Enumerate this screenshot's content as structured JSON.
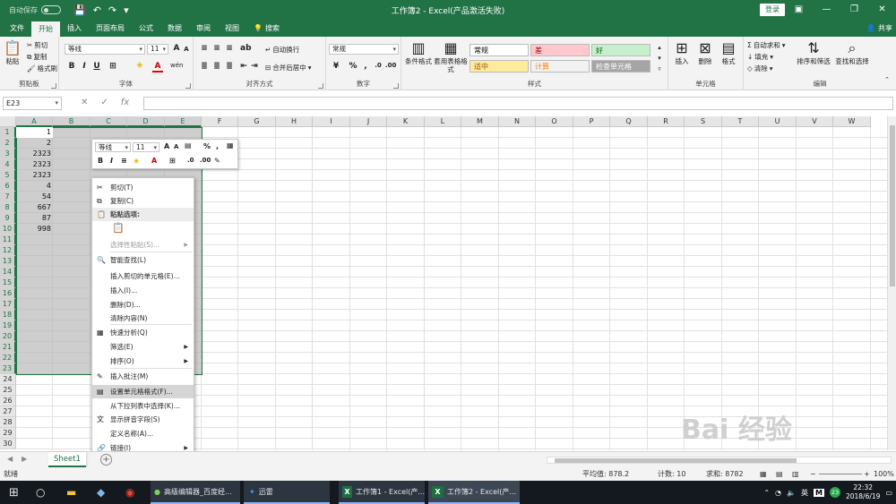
{
  "titlebar": {
    "autosave": "自动保存",
    "autosave_state": "●",
    "doc_title": "工作簿2 - Excel(产品激活失败)",
    "login": "登录"
  },
  "tabs": [
    "文件",
    "开始",
    "插入",
    "页面布局",
    "公式",
    "数据",
    "审阅",
    "视图"
  ],
  "tell_me": "搜索",
  "share": "共享",
  "ribbon": {
    "clipboard": {
      "paste": "粘贴",
      "cut": "剪切",
      "copy": "复制",
      "format_painter": "格式刷",
      "label": "剪贴板"
    },
    "font": {
      "name": "等线",
      "size": "11",
      "bold": "B",
      "italic": "I",
      "underline": "U",
      "grow": "A",
      "shrink": "A",
      "font_color": "A",
      "wen": "wén",
      "label": "字体"
    },
    "alignment": {
      "wrap": "自动换行",
      "merge": "合并后居中",
      "label": "对齐方式"
    },
    "number": {
      "format": "常规",
      "percent": "%",
      "comma": ",",
      "label": "数字"
    },
    "styles": {
      "conditional": "条件格式",
      "table": "套用表格格式",
      "cells": [
        {
          "text": "常规",
          "bg": "#ffffff",
          "color": "#000000"
        },
        {
          "text": "差",
          "bg": "#ffc7ce",
          "color": "#9c0006"
        },
        {
          "text": "好",
          "bg": "#c6efce",
          "color": "#006100"
        },
        {
          "text": "适中",
          "bg": "#ffeb9c",
          "color": "#9c5700"
        },
        {
          "text": "计算",
          "bg": "#f2f2f2",
          "color": "#fa7d00"
        },
        {
          "text": "检查单元格",
          "bg": "#a5a5a5",
          "color": "#ffffff"
        }
      ],
      "label": "样式"
    },
    "cells": {
      "insert": "插入",
      "delete": "删除",
      "format": "格式",
      "label": "单元格"
    },
    "editing": {
      "autosum": "自动求和",
      "fill": "填充",
      "clear": "清除",
      "sort": "排序和筛选",
      "find": "查找和选择",
      "label": "编辑"
    }
  },
  "formula_bar": {
    "name_box": "E23",
    "cancel": "✕",
    "enter": "✓",
    "fx": "fx",
    "value": ""
  },
  "columns": [
    "A",
    "B",
    "C",
    "D",
    "E",
    "F",
    "G",
    "H",
    "I",
    "J",
    "K",
    "L",
    "M",
    "N",
    "O",
    "P",
    "Q",
    "R",
    "S",
    "T",
    "U",
    "V",
    "W"
  ],
  "rows": [
    "1",
    "2",
    "3",
    "4",
    "5",
    "6",
    "7",
    "8",
    "9",
    "10",
    "11",
    "12",
    "13",
    "14",
    "15",
    "16",
    "17",
    "18",
    "19",
    "20",
    "21",
    "22",
    "23",
    "24",
    "25",
    "26",
    "27",
    "28",
    "29",
    "30"
  ],
  "cells_a": [
    "1",
    "2",
    "2323",
    "2323",
    "2323",
    "4",
    "54",
    "667",
    "87",
    "998"
  ],
  "mini_toolbar": {
    "font": "等线",
    "size": "11",
    "percent": "%",
    "comma": ","
  },
  "context_menu": [
    {
      "label": "剪切(T)",
      "icon": "✂",
      "kind": "normal"
    },
    {
      "label": "复制(C)",
      "icon": "⧉",
      "kind": "normal"
    },
    {
      "label": "粘贴选项:",
      "icon": "📋",
      "kind": "header"
    },
    {
      "label": "",
      "icon": "📋",
      "kind": "paste-icon"
    },
    {
      "label": "选择性粘贴(S)...",
      "icon": "",
      "kind": "disabled",
      "sub": true
    },
    {
      "label": "智能查找(L)",
      "icon": "🔍",
      "kind": "normal"
    },
    {
      "label": "插入剪切的单元格(E)...",
      "icon": "",
      "kind": "normal"
    },
    {
      "label": "插入(I)...",
      "icon": "",
      "kind": "normal"
    },
    {
      "label": "删除(D)...",
      "icon": "",
      "kind": "normal"
    },
    {
      "label": "清除内容(N)",
      "icon": "",
      "kind": "normal"
    },
    {
      "label": "快速分析(Q)",
      "icon": "▦",
      "kind": "normal"
    },
    {
      "label": "筛选(E)",
      "icon": "",
      "kind": "normal",
      "sub": true
    },
    {
      "label": "排序(O)",
      "icon": "",
      "kind": "normal",
      "sub": true
    },
    {
      "label": "插入批注(M)",
      "icon": "✎",
      "kind": "normal"
    },
    {
      "label": "设置单元格格式(F)...",
      "icon": "▤",
      "kind": "hover"
    },
    {
      "label": "从下拉列表中选择(K)...",
      "icon": "",
      "kind": "normal"
    },
    {
      "label": "显示拼音字段(S)",
      "icon": "文",
      "kind": "normal"
    },
    {
      "label": "定义名称(A)...",
      "icon": "",
      "kind": "normal"
    },
    {
      "label": "链接(I)",
      "icon": "🔗",
      "kind": "normal",
      "sub": true
    }
  ],
  "sheet": {
    "tab": "Sheet1",
    "add": "+"
  },
  "status": {
    "ready": "就绪",
    "average": "平均值: 878.2",
    "count": "计数: 10",
    "sum": "求和: 8782",
    "zoom": "100%"
  },
  "taskbar": {
    "items": [
      "高级编辑器_百度经...",
      "迅雷",
      "工作簿1 - Excel(产...",
      "工作簿2 - Excel(产..."
    ],
    "ime": "英",
    "ime2": "M",
    "badge": "23",
    "time": "22:32",
    "date": "2018/6/19"
  },
  "watermark": "Bai 经验"
}
